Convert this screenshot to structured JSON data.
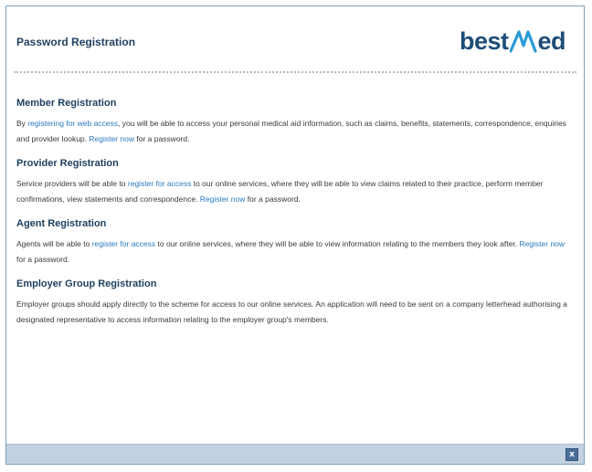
{
  "dialog": {
    "title": "Password Registration",
    "close_label": "x"
  },
  "logo": {
    "part1": "best",
    "part2": "ed",
    "brand_color": "#1e4d78",
    "accent_color": "#2a9bd8"
  },
  "sections": [
    {
      "title": "Member Registration",
      "t1": "By ",
      "l1": "registering for web access",
      "t2": ", you will be able to access your personal medical aid information, such as claims, benefits, statements, correspondence, enquiries and provider lookup. ",
      "l2": "Register now",
      "t3": " for a password."
    },
    {
      "title": "Provider Registration",
      "t1": "Service providers will be able to ",
      "l1": "register for access",
      "t2": " to our online services, where they will be able to view claims related to their practice, perform member confirmations, view statements and correspondence. ",
      "l2": "Register now",
      "t3": " for a password."
    },
    {
      "title": "Agent Registration",
      "t1": "Agents will be able to ",
      "l1": "register for access",
      "t2": " to our online services, where they will be able to view information relating to the members they look after. ",
      "l2": "Register now",
      "t3": " for a password."
    },
    {
      "title": "Employer Group Registration",
      "body": "Employer groups should apply directly to the scheme for access to our online services. An application will need to be sent on a company letterhead authorising a designated representative to access information relating to the employer group's members."
    }
  ],
  "colors": {
    "heading": "#1e3f5e",
    "link": "#2a7ac0",
    "footer": "#c3d2e2"
  }
}
